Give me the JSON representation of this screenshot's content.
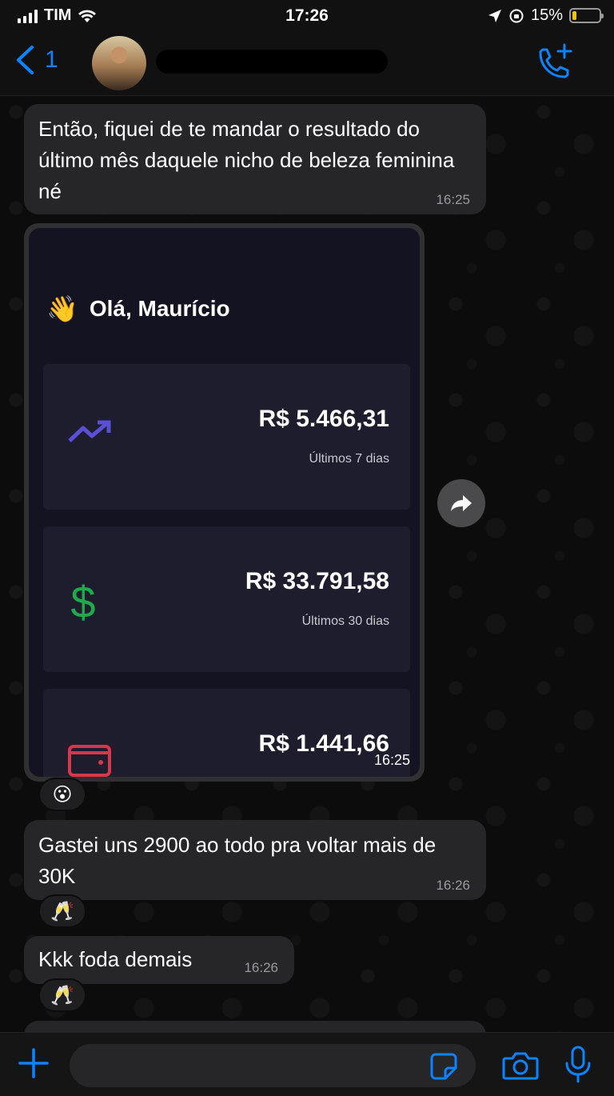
{
  "status_bar": {
    "carrier": "TIM",
    "time": "17:26",
    "battery_percent": "15%",
    "battery_level": 0.15
  },
  "header": {
    "back_count": "1",
    "contact_name": "",
    "icons": [
      "chevron-left-icon",
      "add-call-icon"
    ]
  },
  "messages": [
    {
      "text": "Então, fiquei de te mandar o resultado do último mês daquele nicho de beleza feminina né",
      "time": "16:25"
    },
    {
      "type": "image",
      "time": "16:25",
      "reaction": "😮"
    },
    {
      "text": "Gastei uns 2900 ao todo pra voltar mais de 30K",
      "time": "16:26",
      "reaction": "🥂"
    },
    {
      "text": "Kkk foda demais",
      "time": "16:26",
      "reaction": "🥂"
    }
  ],
  "dashboard": {
    "greeting": "Olá, Maurício",
    "greeting_emoji": "👋",
    "cards": [
      {
        "amount": "R$ 5.466,31",
        "label": "Últimos 7 dias",
        "icon": "trend-up-icon",
        "color": "#5b4fd6"
      },
      {
        "amount": "R$ 33.791,58",
        "label": "Últimos 30 dias",
        "icon": "dollar-icon",
        "color": "#1faa4c"
      },
      {
        "amount": "R$ 1.441,66",
        "label": "",
        "icon": "wallet-icon",
        "color": "#d9364a"
      }
    ]
  },
  "input": {
    "placeholder": ""
  },
  "colors": {
    "accent": "#0a84ff",
    "bubble": "#262628",
    "background": "#0c0c0c"
  }
}
